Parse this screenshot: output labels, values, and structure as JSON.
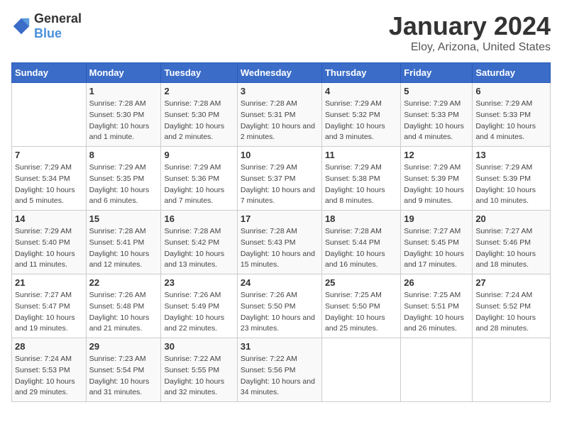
{
  "logo": {
    "general": "General",
    "blue": "Blue"
  },
  "title": "January 2024",
  "location": "Eloy, Arizona, United States",
  "headers": [
    "Sunday",
    "Monday",
    "Tuesday",
    "Wednesday",
    "Thursday",
    "Friday",
    "Saturday"
  ],
  "weeks": [
    [
      {
        "day": "",
        "sunrise": "",
        "sunset": "",
        "daylight": ""
      },
      {
        "day": "1",
        "sunrise": "Sunrise: 7:28 AM",
        "sunset": "Sunset: 5:30 PM",
        "daylight": "Daylight: 10 hours and 1 minute."
      },
      {
        "day": "2",
        "sunrise": "Sunrise: 7:28 AM",
        "sunset": "Sunset: 5:30 PM",
        "daylight": "Daylight: 10 hours and 2 minutes."
      },
      {
        "day": "3",
        "sunrise": "Sunrise: 7:28 AM",
        "sunset": "Sunset: 5:31 PM",
        "daylight": "Daylight: 10 hours and 2 minutes."
      },
      {
        "day": "4",
        "sunrise": "Sunrise: 7:29 AM",
        "sunset": "Sunset: 5:32 PM",
        "daylight": "Daylight: 10 hours and 3 minutes."
      },
      {
        "day": "5",
        "sunrise": "Sunrise: 7:29 AM",
        "sunset": "Sunset: 5:33 PM",
        "daylight": "Daylight: 10 hours and 4 minutes."
      },
      {
        "day": "6",
        "sunrise": "Sunrise: 7:29 AM",
        "sunset": "Sunset: 5:33 PM",
        "daylight": "Daylight: 10 hours and 4 minutes."
      }
    ],
    [
      {
        "day": "7",
        "sunrise": "Sunrise: 7:29 AM",
        "sunset": "Sunset: 5:34 PM",
        "daylight": "Daylight: 10 hours and 5 minutes."
      },
      {
        "day": "8",
        "sunrise": "Sunrise: 7:29 AM",
        "sunset": "Sunset: 5:35 PM",
        "daylight": "Daylight: 10 hours and 6 minutes."
      },
      {
        "day": "9",
        "sunrise": "Sunrise: 7:29 AM",
        "sunset": "Sunset: 5:36 PM",
        "daylight": "Daylight: 10 hours and 7 minutes."
      },
      {
        "day": "10",
        "sunrise": "Sunrise: 7:29 AM",
        "sunset": "Sunset: 5:37 PM",
        "daylight": "Daylight: 10 hours and 7 minutes."
      },
      {
        "day": "11",
        "sunrise": "Sunrise: 7:29 AM",
        "sunset": "Sunset: 5:38 PM",
        "daylight": "Daylight: 10 hours and 8 minutes."
      },
      {
        "day": "12",
        "sunrise": "Sunrise: 7:29 AM",
        "sunset": "Sunset: 5:39 PM",
        "daylight": "Daylight: 10 hours and 9 minutes."
      },
      {
        "day": "13",
        "sunrise": "Sunrise: 7:29 AM",
        "sunset": "Sunset: 5:39 PM",
        "daylight": "Daylight: 10 hours and 10 minutes."
      }
    ],
    [
      {
        "day": "14",
        "sunrise": "Sunrise: 7:29 AM",
        "sunset": "Sunset: 5:40 PM",
        "daylight": "Daylight: 10 hours and 11 minutes."
      },
      {
        "day": "15",
        "sunrise": "Sunrise: 7:28 AM",
        "sunset": "Sunset: 5:41 PM",
        "daylight": "Daylight: 10 hours and 12 minutes."
      },
      {
        "day": "16",
        "sunrise": "Sunrise: 7:28 AM",
        "sunset": "Sunset: 5:42 PM",
        "daylight": "Daylight: 10 hours and 13 minutes."
      },
      {
        "day": "17",
        "sunrise": "Sunrise: 7:28 AM",
        "sunset": "Sunset: 5:43 PM",
        "daylight": "Daylight: 10 hours and 15 minutes."
      },
      {
        "day": "18",
        "sunrise": "Sunrise: 7:28 AM",
        "sunset": "Sunset: 5:44 PM",
        "daylight": "Daylight: 10 hours and 16 minutes."
      },
      {
        "day": "19",
        "sunrise": "Sunrise: 7:27 AM",
        "sunset": "Sunset: 5:45 PM",
        "daylight": "Daylight: 10 hours and 17 minutes."
      },
      {
        "day": "20",
        "sunrise": "Sunrise: 7:27 AM",
        "sunset": "Sunset: 5:46 PM",
        "daylight": "Daylight: 10 hours and 18 minutes."
      }
    ],
    [
      {
        "day": "21",
        "sunrise": "Sunrise: 7:27 AM",
        "sunset": "Sunset: 5:47 PM",
        "daylight": "Daylight: 10 hours and 19 minutes."
      },
      {
        "day": "22",
        "sunrise": "Sunrise: 7:26 AM",
        "sunset": "Sunset: 5:48 PM",
        "daylight": "Daylight: 10 hours and 21 minutes."
      },
      {
        "day": "23",
        "sunrise": "Sunrise: 7:26 AM",
        "sunset": "Sunset: 5:49 PM",
        "daylight": "Daylight: 10 hours and 22 minutes."
      },
      {
        "day": "24",
        "sunrise": "Sunrise: 7:26 AM",
        "sunset": "Sunset: 5:50 PM",
        "daylight": "Daylight: 10 hours and 23 minutes."
      },
      {
        "day": "25",
        "sunrise": "Sunrise: 7:25 AM",
        "sunset": "Sunset: 5:50 PM",
        "daylight": "Daylight: 10 hours and 25 minutes."
      },
      {
        "day": "26",
        "sunrise": "Sunrise: 7:25 AM",
        "sunset": "Sunset: 5:51 PM",
        "daylight": "Daylight: 10 hours and 26 minutes."
      },
      {
        "day": "27",
        "sunrise": "Sunrise: 7:24 AM",
        "sunset": "Sunset: 5:52 PM",
        "daylight": "Daylight: 10 hours and 28 minutes."
      }
    ],
    [
      {
        "day": "28",
        "sunrise": "Sunrise: 7:24 AM",
        "sunset": "Sunset: 5:53 PM",
        "daylight": "Daylight: 10 hours and 29 minutes."
      },
      {
        "day": "29",
        "sunrise": "Sunrise: 7:23 AM",
        "sunset": "Sunset: 5:54 PM",
        "daylight": "Daylight: 10 hours and 31 minutes."
      },
      {
        "day": "30",
        "sunrise": "Sunrise: 7:22 AM",
        "sunset": "Sunset: 5:55 PM",
        "daylight": "Daylight: 10 hours and 32 minutes."
      },
      {
        "day": "31",
        "sunrise": "Sunrise: 7:22 AM",
        "sunset": "Sunset: 5:56 PM",
        "daylight": "Daylight: 10 hours and 34 minutes."
      },
      {
        "day": "",
        "sunrise": "",
        "sunset": "",
        "daylight": ""
      },
      {
        "day": "",
        "sunrise": "",
        "sunset": "",
        "daylight": ""
      },
      {
        "day": "",
        "sunrise": "",
        "sunset": "",
        "daylight": ""
      }
    ]
  ]
}
